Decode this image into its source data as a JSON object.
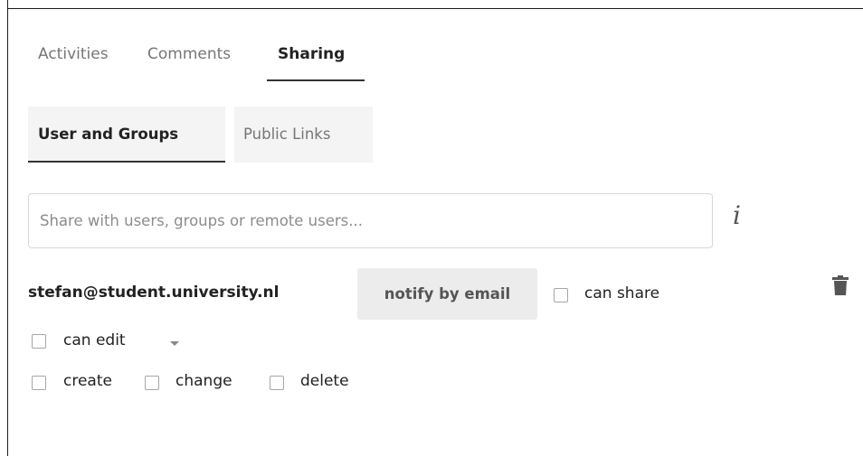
{
  "tabs": [
    {
      "label": "Activities"
    },
    {
      "label": "Comments"
    },
    {
      "label": "Sharing"
    }
  ],
  "subtabs": [
    {
      "label": "User and Groups"
    },
    {
      "label": "Public Links"
    }
  ],
  "search": {
    "placeholder": "Share with users, groups or remote users...",
    "value": ""
  },
  "info_icon": "i",
  "share": {
    "email": "stefan@student.university.nl",
    "notify_label": "notify by email",
    "can_share_label": "can share",
    "permission_label": "can edit",
    "create_label": "create",
    "change_label": "change",
    "delete_label": "delete"
  },
  "icons": {
    "info": "info-icon",
    "delete": "trash-icon",
    "dropdown": "chevron-down-icon"
  },
  "colors": {
    "active_underline": "#333333",
    "tab_bg": "#f4f4f4",
    "notify_bg": "#ececec"
  }
}
